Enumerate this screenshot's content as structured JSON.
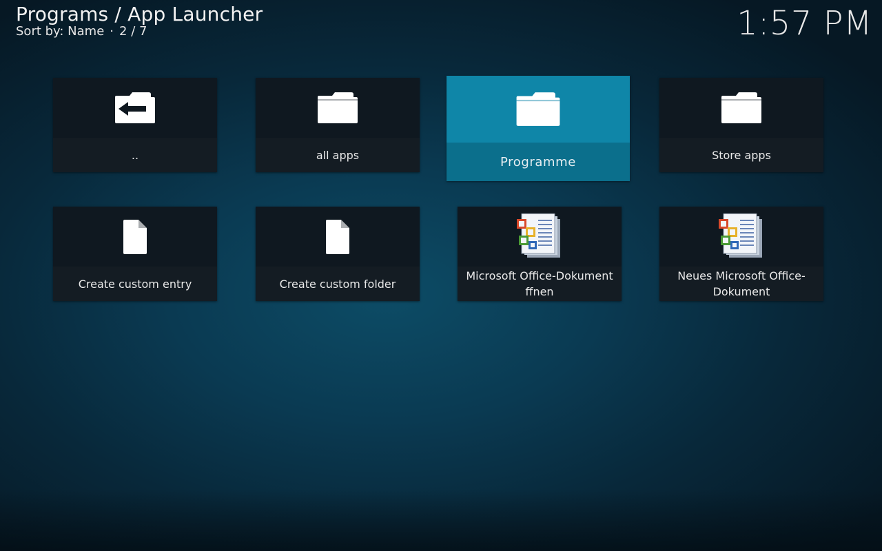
{
  "header": {
    "title": "Programs / App Launcher",
    "sort_label": "Sort by: Name",
    "separator": "·",
    "position": "2 / 7"
  },
  "clock": "1:57 PM",
  "colors": {
    "focus_accent": "#0f86a8",
    "tile_background": "#111a21"
  },
  "items": [
    {
      "label": "..",
      "icon": "folder-back-icon"
    },
    {
      "label": "all apps",
      "icon": "folder-icon"
    },
    {
      "label": "Programme",
      "icon": "folder-icon",
      "focused": true
    },
    {
      "label": "Store apps",
      "icon": "folder-icon"
    },
    {
      "label": "Create custom entry",
      "icon": "file-icon"
    },
    {
      "label": "Create custom folder",
      "icon": "file-icon"
    },
    {
      "label": "Microsoft Office-Dokument ffnen",
      "icon": "office-document-icon"
    },
    {
      "label": "Neues Microsoft Office-Dokument",
      "icon": "office-document-icon"
    }
  ]
}
